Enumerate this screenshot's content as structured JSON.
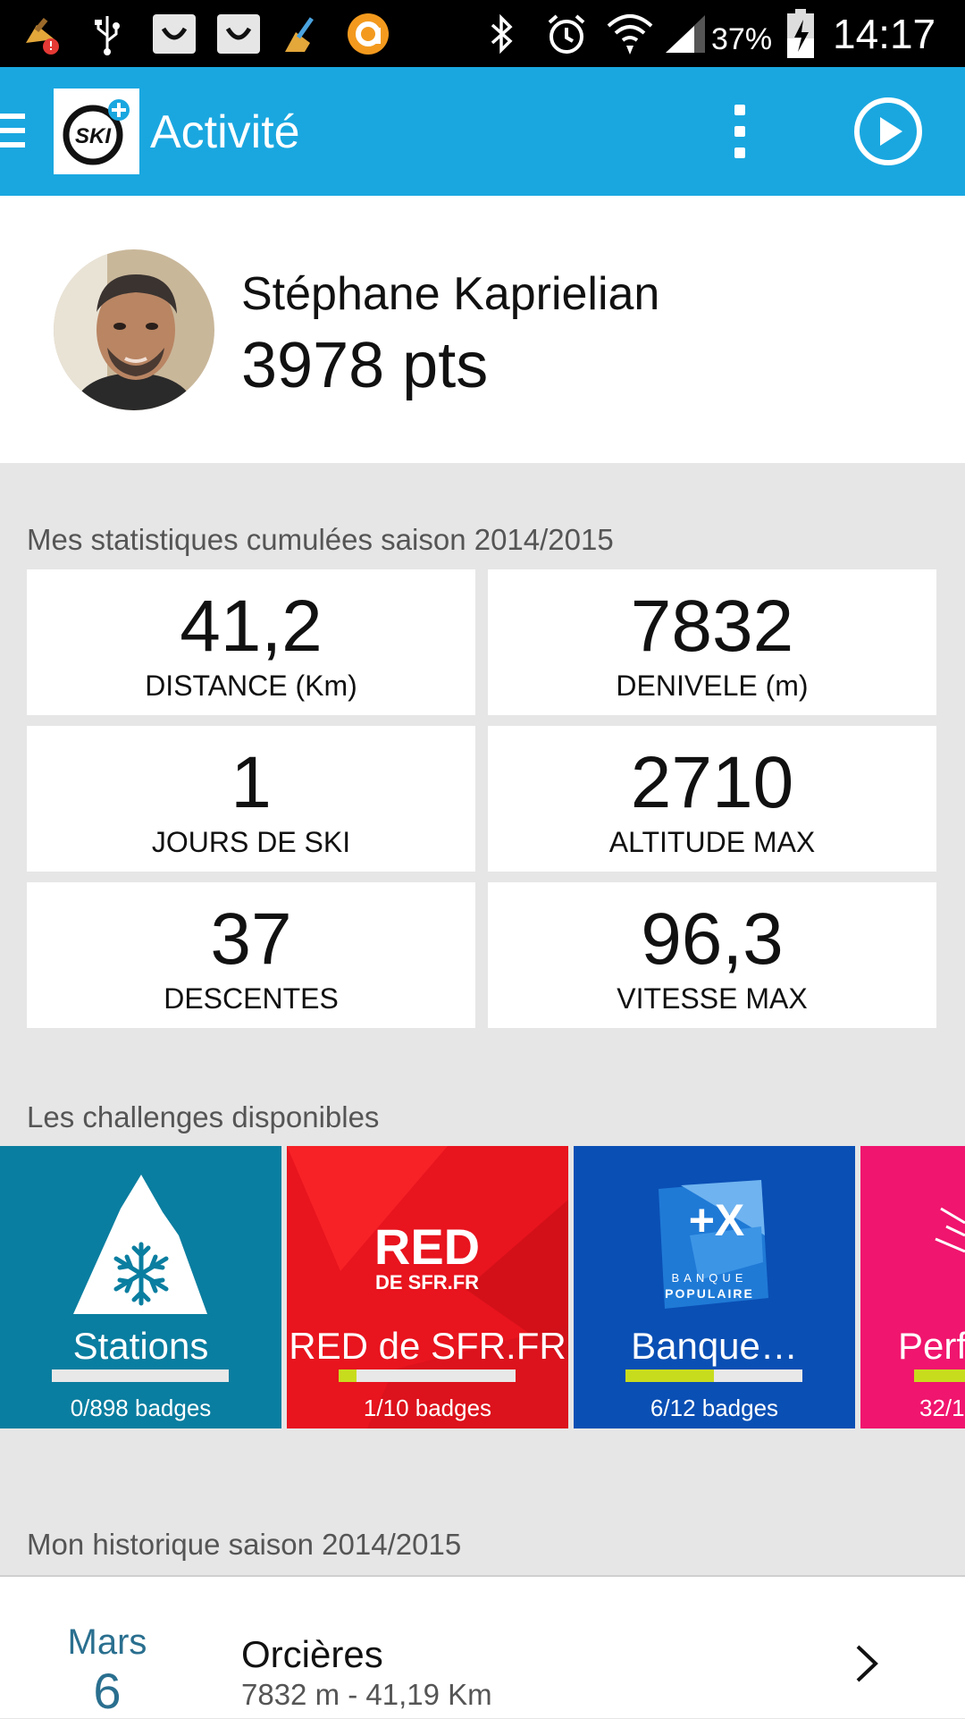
{
  "status_bar": {
    "battery_percent": "37%",
    "time": "14:17",
    "icons": [
      "clean-master-icon",
      "usb-icon",
      "smiley-icon",
      "smiley-icon",
      "broom-icon",
      "orange-app-icon",
      "bluetooth-icon",
      "alarm-icon",
      "wifi-icon",
      "signal-icon",
      "battery-icon"
    ]
  },
  "app_bar": {
    "title": "Activité",
    "logo_text": "SKI",
    "background_color": "#1aa7e0"
  },
  "profile": {
    "name": "Stéphane Kaprielian",
    "points": "3978 pts"
  },
  "stats": {
    "section_title": "Mes statistiques cumulées saison 2014/2015",
    "items": [
      {
        "value": "41,2",
        "label": "DISTANCE (Km)"
      },
      {
        "value": "7832",
        "label": "DENIVELE (m)"
      },
      {
        "value": "1",
        "label": "JOURS DE SKI"
      },
      {
        "value": "2710",
        "label": "ALTITUDE MAX"
      },
      {
        "value": "37",
        "label": "DESCENTES"
      },
      {
        "value": "96,3",
        "label": "VITESSE MAX"
      }
    ]
  },
  "challenges": {
    "section_title": "Les challenges disponibles",
    "items": [
      {
        "name": "Stations",
        "badges": "0/898 badges",
        "progress": 0.0,
        "color": "#0a7ea0",
        "logo_text": ""
      },
      {
        "name": "RED de SFR.FR",
        "badges": "1/10 badges",
        "progress": 0.1,
        "color": "#e8141e",
        "logo_text": "RED",
        "logo_subtext": "DE SFR.FR"
      },
      {
        "name": "Banque…",
        "badges": "6/12 badges",
        "progress": 0.5,
        "color": "#0a4fb4",
        "logo_text": "+X",
        "logo_subtext": "BANQUE POPULAIRE"
      },
      {
        "name": "Perf",
        "badges": "32/1",
        "progress": 0.4,
        "color": "#f0156e",
        "logo_text": ""
      }
    ]
  },
  "history": {
    "section_title": "Mon historique saison 2014/2015",
    "items": [
      {
        "month": "Mars",
        "day": "6",
        "place": "Orcières",
        "details": "7832 m - 41,19 Km"
      }
    ]
  }
}
